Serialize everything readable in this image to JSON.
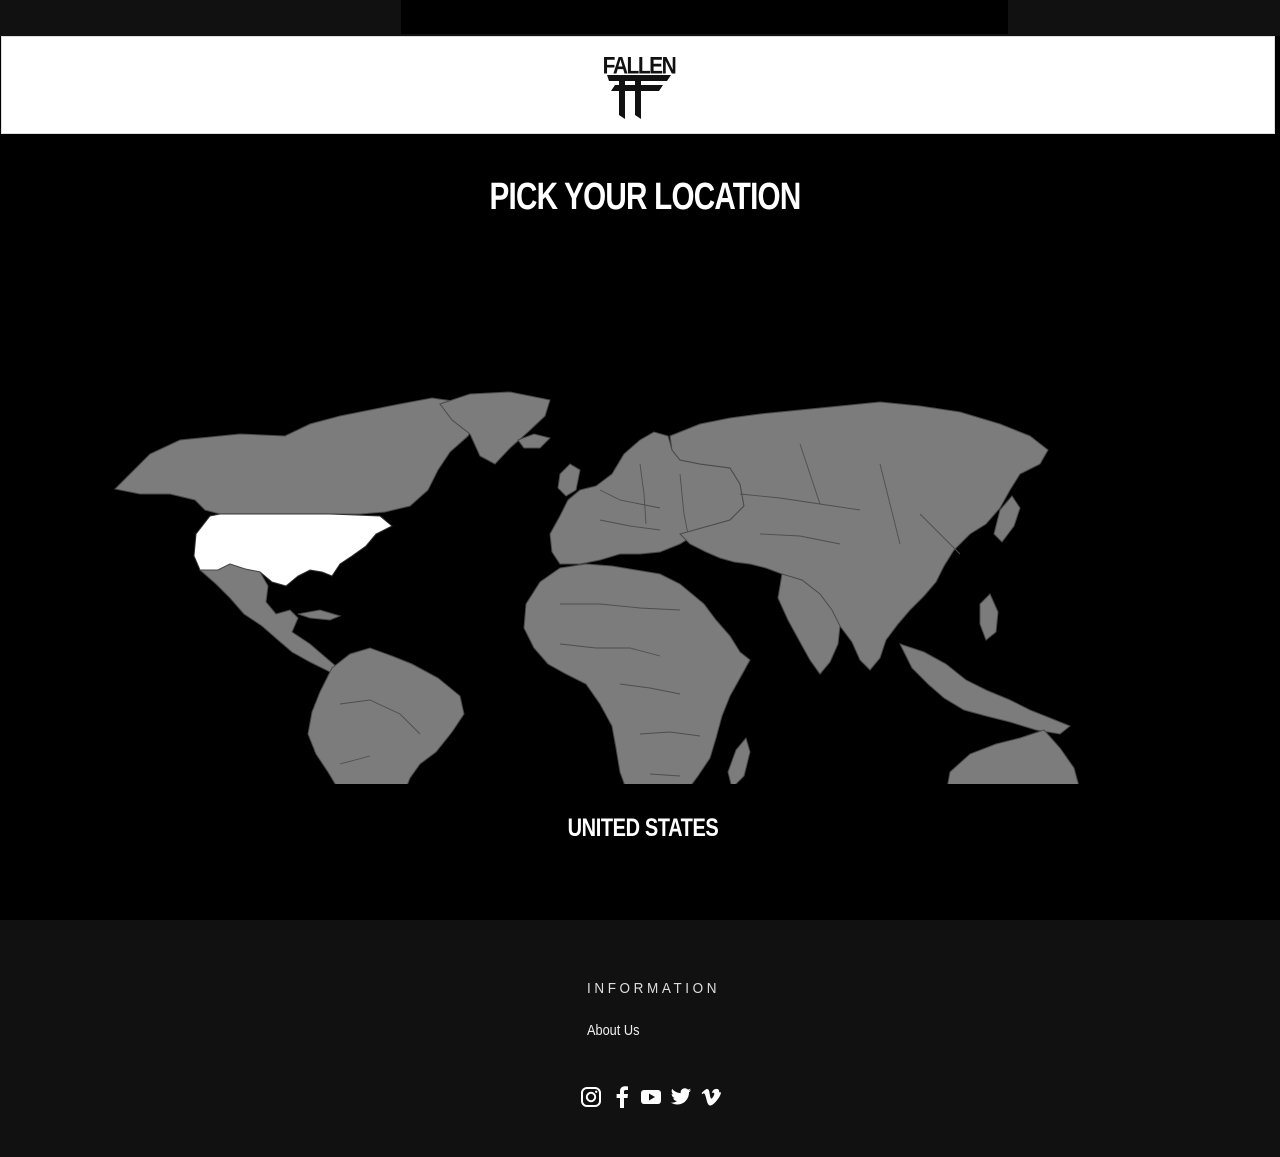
{
  "brand": {
    "logo_text": "FALLEN"
  },
  "main": {
    "title": "PICK YOUR LOCATION",
    "selected_country": "UNITED STATES"
  },
  "map": {
    "highlight_color": "#ffffff",
    "land_color": "#7c7c7c",
    "background_color": "#000000"
  },
  "footer": {
    "heading": "INFORMATION",
    "links": [
      {
        "label": "About Us"
      }
    ],
    "social": [
      "instagram-icon",
      "facebook-icon",
      "youtube-icon",
      "twitter-icon",
      "vimeo-icon"
    ]
  }
}
